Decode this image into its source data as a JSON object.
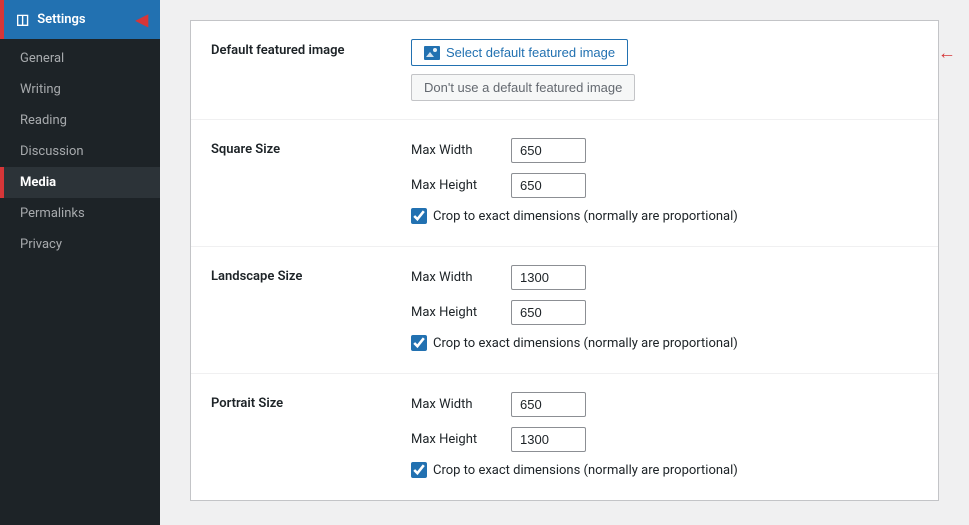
{
  "sidebar": {
    "settings_label": "Settings",
    "nav_items": [
      {
        "id": "general",
        "label": "General",
        "active": false,
        "bold": false
      },
      {
        "id": "writing",
        "label": "Writing",
        "active": false,
        "bold": false
      },
      {
        "id": "reading",
        "label": "Reading",
        "active": false,
        "bold": false
      },
      {
        "id": "discussion",
        "label": "Discussion",
        "active": false,
        "bold": false
      },
      {
        "id": "media",
        "label": "Media",
        "active": true,
        "bold": true
      },
      {
        "id": "permalinks",
        "label": "Permalinks",
        "active": false,
        "bold": false
      },
      {
        "id": "privacy",
        "label": "Privacy",
        "active": false,
        "bold": false
      }
    ]
  },
  "main": {
    "sections": [
      {
        "id": "default-featured-image",
        "label": "Default featured image",
        "btn_select_label": "Select default featured image",
        "btn_no_image_label": "Don't use a default featured image"
      },
      {
        "id": "square-size",
        "label": "Square Size",
        "max_width_label": "Max Width",
        "max_height_label": "Max Height",
        "max_width_value": "650",
        "max_height_value": "650",
        "crop_label": "Crop to exact dimensions (normally are proportional)"
      },
      {
        "id": "landscape-size",
        "label": "Landscape Size",
        "max_width_label": "Max Width",
        "max_height_label": "Max Height",
        "max_width_value": "1300",
        "max_height_value": "650",
        "crop_label": "Crop to exact dimensions (normally are proportional)"
      },
      {
        "id": "portrait-size",
        "label": "Portrait Size",
        "max_width_label": "Max Width",
        "max_height_label": "Max Height",
        "max_width_value": "650",
        "max_height_value": "1300",
        "crop_label": "Crop to exact dimensions (normally are proportional)"
      }
    ]
  }
}
